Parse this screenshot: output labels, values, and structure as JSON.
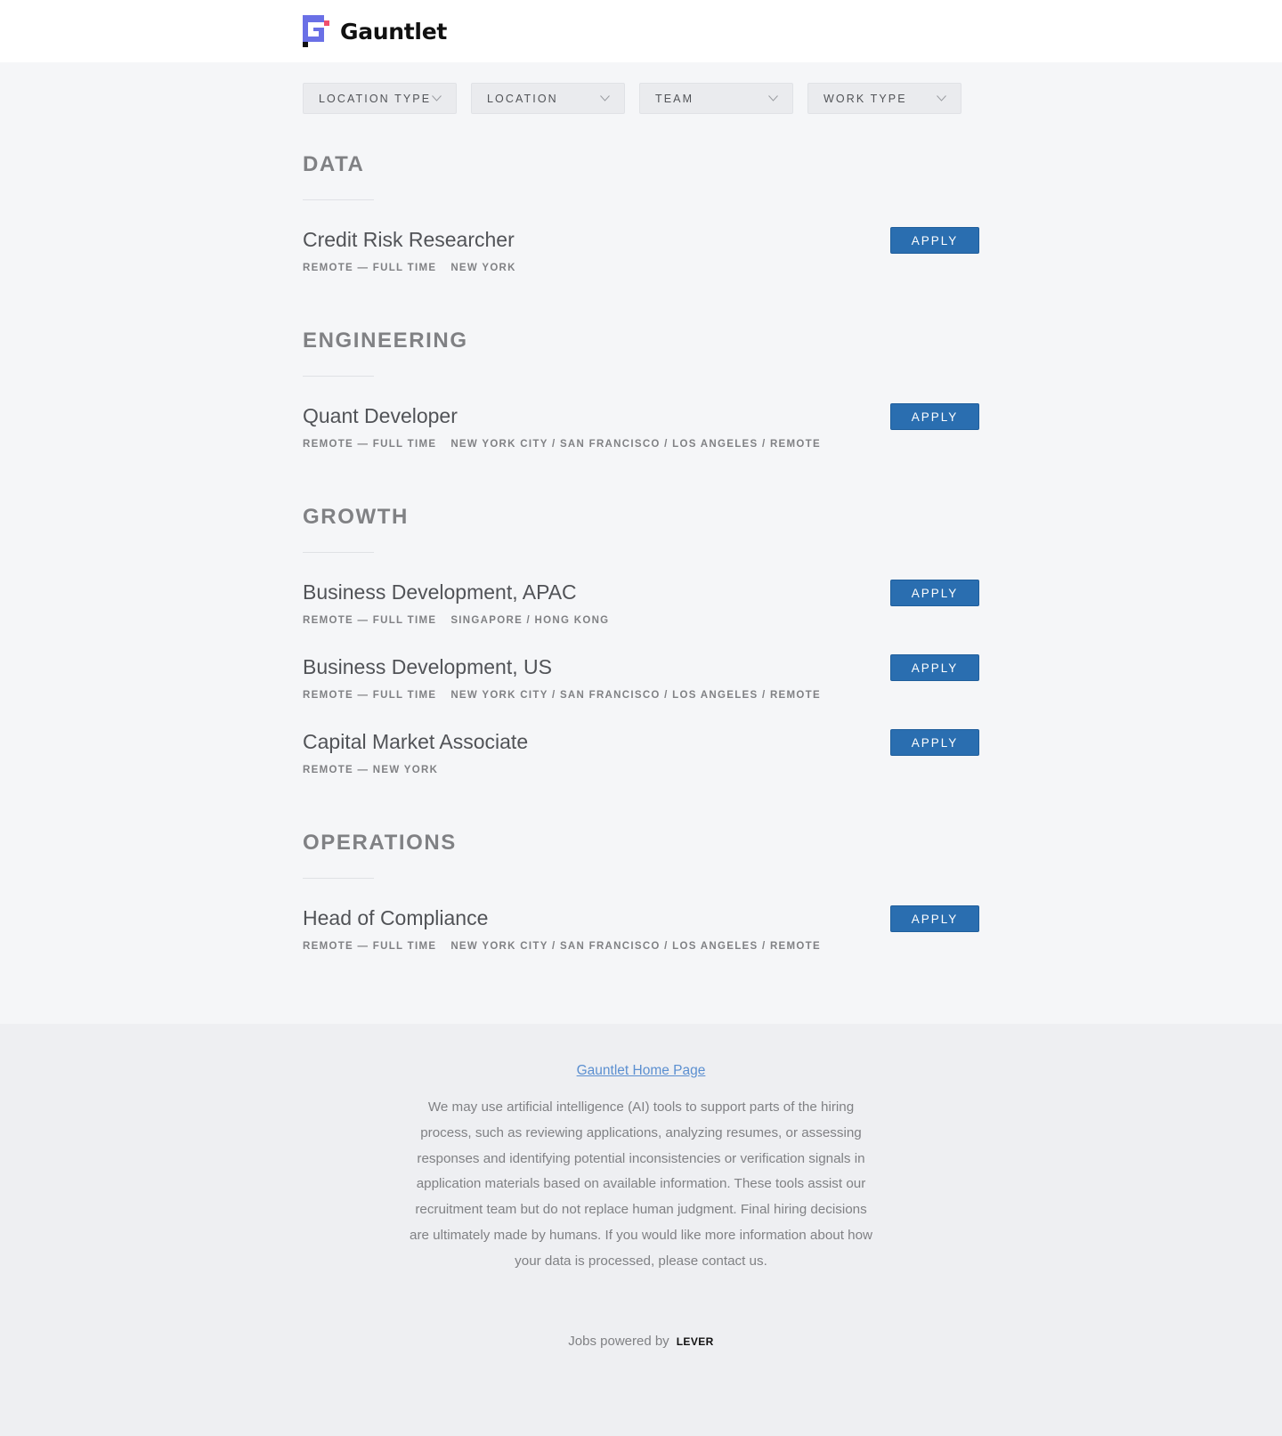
{
  "header": {
    "brand_name": "Gauntlet",
    "brand_colors": {
      "primary": "#6a70e6",
      "accent": "#f0506e",
      "dark": "#111111"
    }
  },
  "filters": [
    {
      "label": "LOCATION TYPE"
    },
    {
      "label": "LOCATION"
    },
    {
      "label": "TEAM"
    },
    {
      "label": "WORK TYPE"
    }
  ],
  "groups": [
    {
      "title": "DATA",
      "postings": [
        {
          "title": "Credit Risk Researcher",
          "commitment": "REMOTE — FULL TIME",
          "location": "NEW YORK",
          "apply_label": "APPLY"
        }
      ]
    },
    {
      "title": "ENGINEERING",
      "postings": [
        {
          "title": "Quant Developer",
          "commitment": "REMOTE — FULL TIME",
          "location": "NEW YORK CITY / SAN FRANCISCO / LOS ANGELES / REMOTE",
          "apply_label": "APPLY"
        }
      ]
    },
    {
      "title": "GROWTH",
      "postings": [
        {
          "title": "Business Development, APAC",
          "commitment": "REMOTE — FULL TIME",
          "location": "SINGAPORE / HONG KONG",
          "apply_label": "APPLY"
        },
        {
          "title": "Business Development, US",
          "commitment": "REMOTE — FULL TIME",
          "location": "NEW YORK CITY / SAN FRANCISCO / LOS ANGELES / REMOTE",
          "apply_label": "APPLY"
        },
        {
          "title": "Capital Market Associate",
          "commitment": "REMOTE — NEW YORK",
          "location": "",
          "apply_label": "APPLY"
        }
      ]
    },
    {
      "title": "OPERATIONS",
      "postings": [
        {
          "title": "Head of Compliance",
          "commitment": "REMOTE — FULL TIME",
          "location": "NEW YORK CITY / SAN FRANCISCO / LOS ANGELES / REMOTE",
          "apply_label": "APPLY"
        }
      ]
    }
  ],
  "footer": {
    "home_link": "Gauntlet Home Page",
    "disclaimer": "We may use artificial intelligence (AI) tools to support parts of the hiring process, such as reviewing applications, analyzing resumes, or assessing responses and identifying potential inconsistencies or verification signals in application materials based on available information. These tools assist our recruitment team but do not replace human judgment. Final hiring decisions are ultimately made by humans. If you would like more information about how your data is processed, please contact us.",
    "powered_by": "Jobs powered by",
    "powered_by_brand": "LEVER"
  },
  "colors": {
    "apply_button": "#2a6eb0",
    "link": "#5b8fd0",
    "page_background": "#f5f6f8",
    "footer_background": "#eeeff2"
  }
}
